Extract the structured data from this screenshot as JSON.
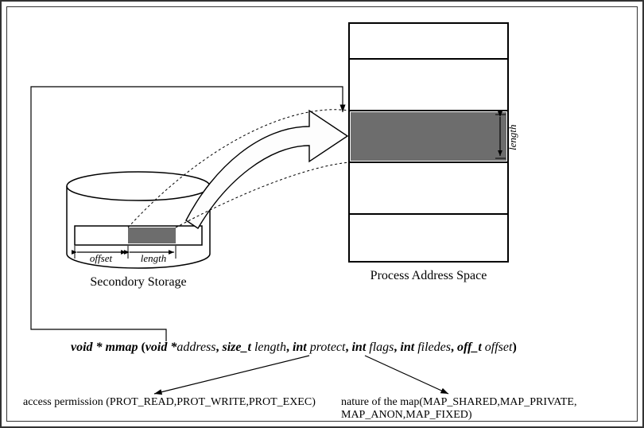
{
  "labels": {
    "secondary_storage": "Secondory Storage",
    "process_address_space": "Process Address Space",
    "offset": "offset",
    "length_disk": "length",
    "length_memory": "length"
  },
  "signature": {
    "ret_type": "void * ",
    "fn_name": "mmap ",
    "open_paren": "(",
    "p1_type": "void *",
    "p1_name": "address",
    "sep": ", ",
    "p2_type": "size_t ",
    "p2_name": "length",
    "p3_type": "int ",
    "p3_name": "protect",
    "p4_type": "int ",
    "p4_name": "flags",
    "p5_type": "int ",
    "p5_name": "filedes",
    "p6_type": "off_t ",
    "p6_name": "offset",
    "close_paren": ")"
  },
  "annotations": {
    "access_permission": "access permission (PROT_READ,PROT_WRITE,PROT_EXEC)",
    "nature_of_map_line1": "nature of the map(MAP_SHARED,MAP_PRIVATE,",
    "nature_of_map_line2": "MAP_ANON,MAP_FIXED)"
  }
}
